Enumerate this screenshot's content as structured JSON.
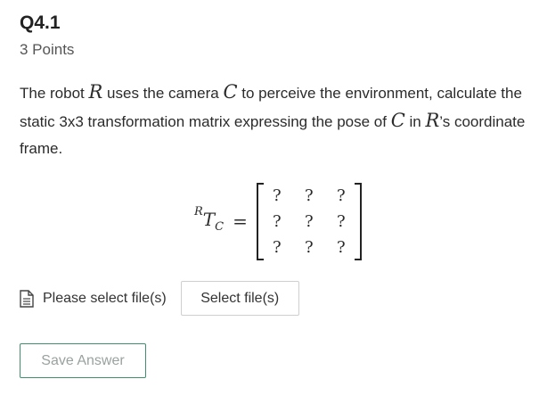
{
  "question": {
    "title": "Q4.1",
    "points": "3 Points",
    "text_1": "The robot ",
    "robot_symbol": "R",
    "text_2": " uses the camera ",
    "camera_symbol": "C",
    "text_3": " to perceive the environment, calculate the static 3x3 transformation matrix expressing the pose of ",
    "camera_symbol_2": "C",
    "text_4": " in ",
    "robot_symbol_2": "R",
    "text_5": "’s coordinate frame."
  },
  "equation": {
    "superscript": "R",
    "base": "T",
    "subscript": "C",
    "equals": "=",
    "matrix": [
      [
        "?",
        "?",
        "?"
      ],
      [
        "?",
        "?",
        "?"
      ],
      [
        "?",
        "?",
        "?"
      ]
    ]
  },
  "upload": {
    "icon": "file-icon",
    "label": "Please select file(s)",
    "button_label": "Select file(s)"
  },
  "save_button_label": "Save Answer",
  "colors": {
    "save_border": "#3f8f6d",
    "save_text": "#9aa2a0",
    "select_border": "#cfcfcf"
  }
}
